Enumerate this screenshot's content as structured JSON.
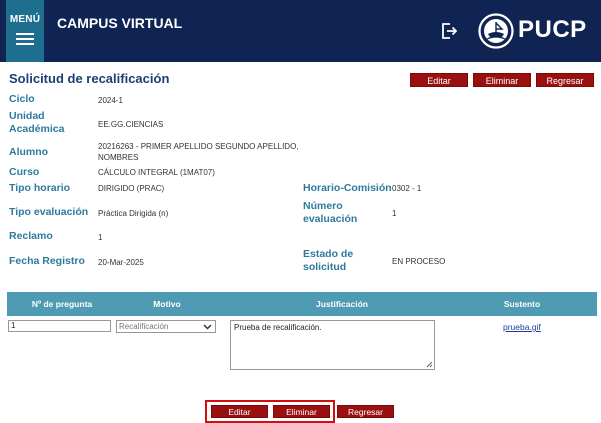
{
  "header": {
    "menu_label": "MENÚ",
    "app_title": "CAMPUS VIRTUAL",
    "brand": "PUCP"
  },
  "page": {
    "title": "Solicitud de recalificación",
    "actions": {
      "edit": "Editar",
      "delete": "Eliminar",
      "back": "Regresar"
    }
  },
  "fields": {
    "ciclo": {
      "label": "Ciclo",
      "value": "2024-1"
    },
    "unidad": {
      "label_1": "Unidad",
      "label_2": "Académica",
      "value": "EE.GG.CIENCIAS"
    },
    "alumno": {
      "label": "Alumno",
      "value_1": "20216263 - PRIMER APELLIDO SEGUNDO APELLIDO,",
      "value_2": "NOMBRES"
    },
    "curso": {
      "label": "Curso",
      "value": "CÁLCULO INTEGRAL (1MAT07)"
    },
    "tipo_horario": {
      "label": "Tipo horario",
      "value": "DIRIGIDO (PRAC)"
    },
    "horario_comision": {
      "label": "Horario-Comisión",
      "value": "0302 - 1"
    },
    "tipo_evaluacion": {
      "label": "Tipo evaluación",
      "value": "Práctica Dirigida (n)"
    },
    "numero_evaluacion": {
      "label_1": "Número",
      "label_2": "evaluación",
      "value": "1"
    },
    "reclamo": {
      "label": "Reclamo",
      "value": "1"
    },
    "fecha_registro": {
      "label": "Fecha Registro",
      "value": "20-Mar-2025"
    },
    "estado_solicitud": {
      "label_1": "Estado de",
      "label_2": "solicitud",
      "value": "EN PROCESO"
    }
  },
  "table": {
    "headers": [
      "Nº de pregunta",
      "Motivo",
      "Justificación",
      "Sustento"
    ],
    "row": {
      "pregunta": "1",
      "motivo": "Recalificación",
      "justificacion": "Prueba de recalificación.",
      "sustento": "prueba.gif"
    }
  },
  "bottom_actions": {
    "edit": "Editar",
    "delete": "Eliminar",
    "back": "Regresar"
  },
  "colors": {
    "header_bg": "#0f2452",
    "menu_bg": "#1e6f8f",
    "button_bg": "#9a1010",
    "label": "#2d7a9c",
    "table_header": "#4f9bb3",
    "focus_border": "#d01010"
  }
}
